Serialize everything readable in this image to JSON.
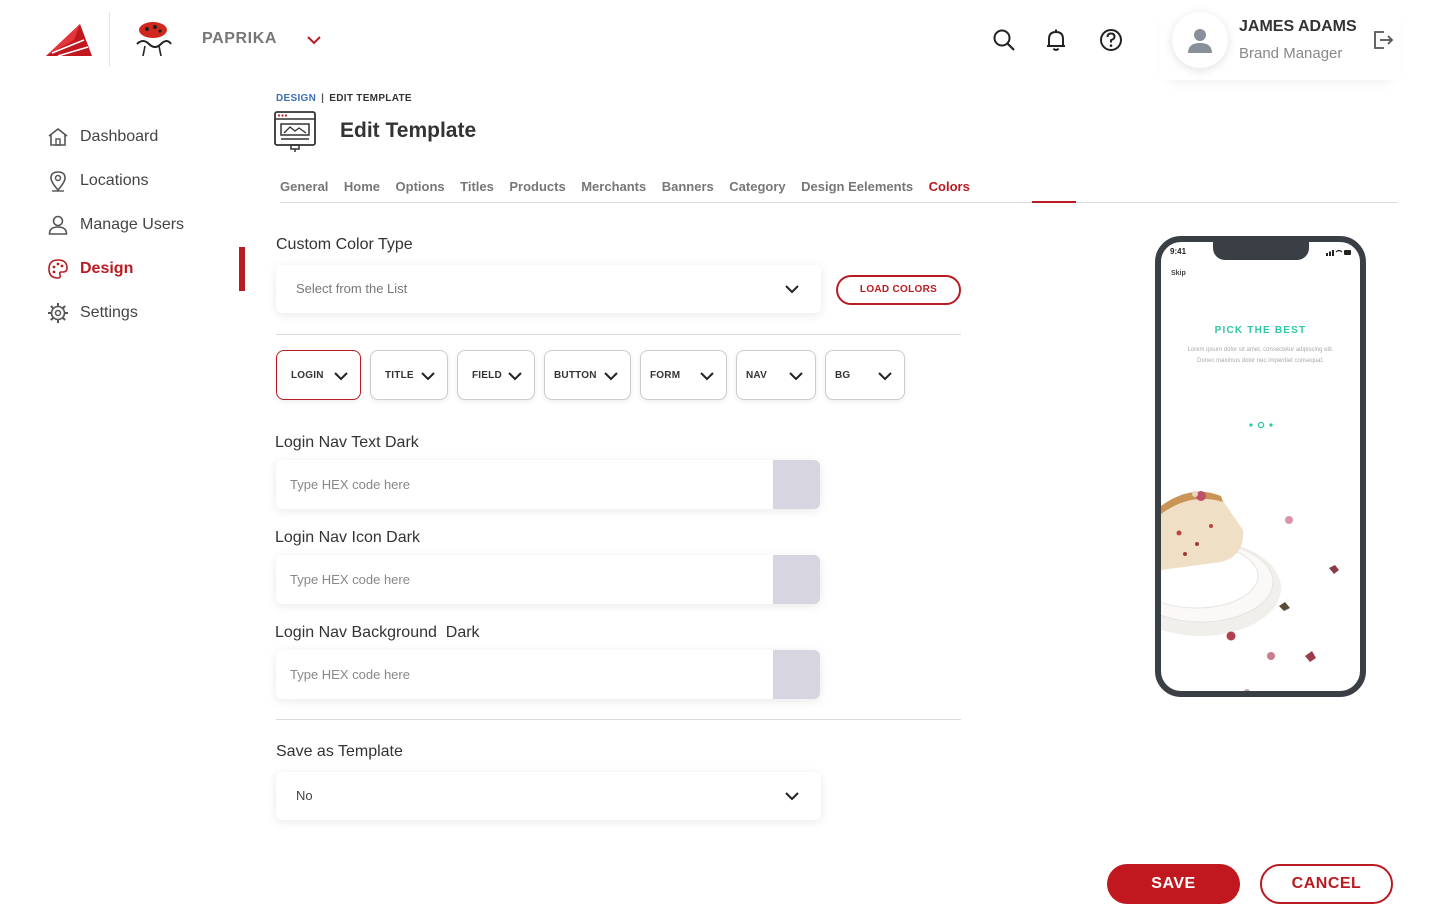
{
  "header": {
    "brand_name": "PAPRIKA",
    "brand_logo_icon": "red-paper-plane-icon",
    "restaurant_logo_icon": "paprika-logo-icon",
    "icons": [
      "search-icon",
      "bell-icon",
      "help-icon",
      "logout-icon"
    ],
    "user": {
      "name": "JAMES ADAMS",
      "role": "Brand Manager"
    }
  },
  "sidebar": {
    "items": [
      {
        "label": "Dashboard",
        "icon": "home-icon"
      },
      {
        "label": "Locations",
        "icon": "location-pin-icon"
      },
      {
        "label": "Manage Users",
        "icon": "user-icon"
      },
      {
        "label": "Design",
        "icon": "palette-icon",
        "active": true
      },
      {
        "label": "Settings",
        "icon": "gear-icon"
      }
    ]
  },
  "breadcrumb": {
    "parent": "DESIGN",
    "separator": "|",
    "current": "EDIT TEMPLATE"
  },
  "page": {
    "title": "Edit Template"
  },
  "tabs": [
    "General",
    "Home",
    "Options",
    "Titles",
    "Products",
    "Merchants",
    "Banners",
    "Category",
    "Design Eelements",
    "Colors"
  ],
  "active_tab": "Colors",
  "custom_color_type": {
    "label": "Custom Color Type",
    "placeholder": "Select from the List",
    "load_button": "LOAD COLORS"
  },
  "chips": [
    "LOGIN",
    "TITLE",
    "FIELD",
    "BUTTON",
    "FORM",
    "NAV",
    "BG"
  ],
  "active_chip": "LOGIN",
  "color_fields": [
    {
      "label": "Login Nav Text Dark",
      "placeholder": "Type HEX code here",
      "swatch": "#d7d6e0"
    },
    {
      "label": "Login Nav Icon Dark",
      "placeholder": "Type HEX code here",
      "swatch": "#d7d6e0"
    },
    {
      "label": "Login Nav Background  Dark",
      "placeholder": "Type HEX code here",
      "swatch": "#d7d6e0"
    }
  ],
  "save_as_template": {
    "label": "Save as Template",
    "value": "No"
  },
  "phone_preview": {
    "time": "9:41",
    "skip": "Skip",
    "title": "PICK THE BEST",
    "body": "Lorem ipsum dolor sit amet, consectetur adipiscing elit. Donec maximus dolor nec imperdiet consequat."
  },
  "footer": {
    "save": "SAVE",
    "cancel": "CANCEL"
  },
  "colors": {
    "accent": "#b81c22",
    "link": "#3d6fb4",
    "phone_title": "#2ec7a5"
  }
}
